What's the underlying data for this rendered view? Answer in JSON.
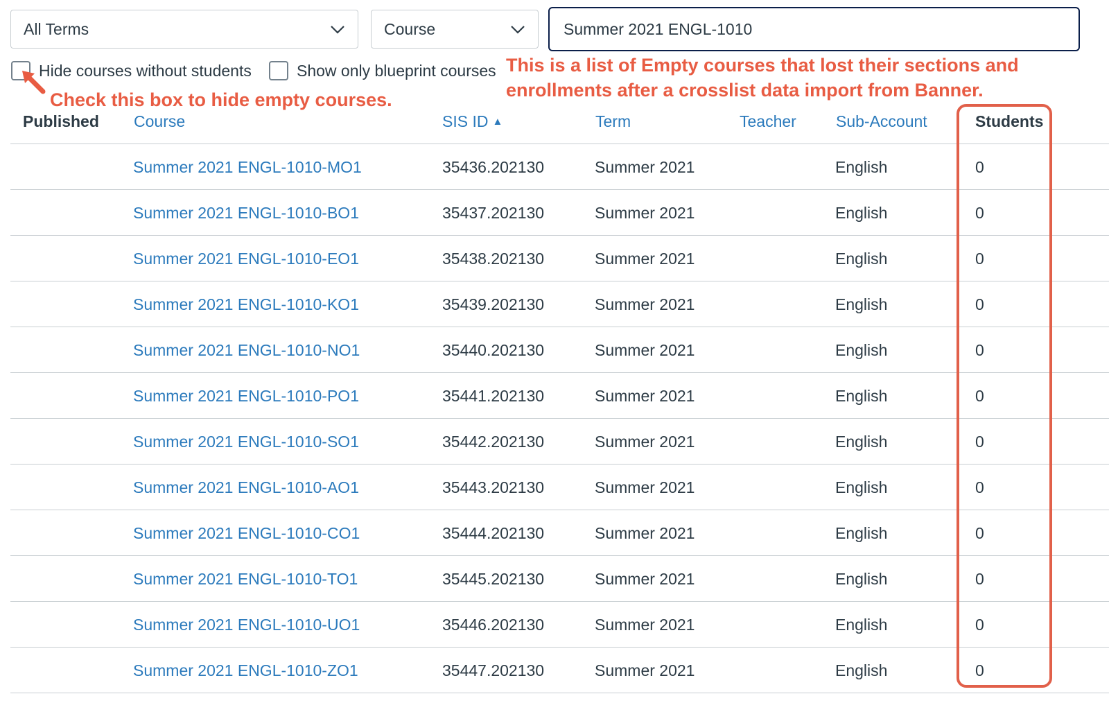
{
  "filters": {
    "term_select": "All Terms",
    "type_select": "Course",
    "search_value": "Summer 2021 ENGL-1010",
    "hide_without_students_label": "Hide courses without students",
    "blueprint_only_label": "Show only blueprint courses"
  },
  "annotations": {
    "list_note_line1": "This is a list of Empty courses that lost their sections and",
    "list_note_line2": "enrollments after a crosslist data import from Banner.",
    "checkbox_note": "Check this box to hide empty courses.",
    "accent_color": "#e85c43"
  },
  "table": {
    "headers": {
      "published": "Published",
      "course": "Course",
      "sis_id": "SIS ID",
      "sort_indicator": "▲",
      "term": "Term",
      "teacher": "Teacher",
      "sub_account": "Sub-Account",
      "students": "Students"
    },
    "rows": [
      {
        "course": "Summer 2021 ENGL-1010-MO1",
        "sis_id": "35436.202130",
        "term": "Summer 2021",
        "teacher": "",
        "sub_account": "English",
        "students": "0"
      },
      {
        "course": "Summer 2021 ENGL-1010-BO1",
        "sis_id": "35437.202130",
        "term": "Summer 2021",
        "teacher": "",
        "sub_account": "English",
        "students": "0"
      },
      {
        "course": "Summer 2021 ENGL-1010-EO1",
        "sis_id": "35438.202130",
        "term": "Summer 2021",
        "teacher": "",
        "sub_account": "English",
        "students": "0"
      },
      {
        "course": "Summer 2021 ENGL-1010-KO1",
        "sis_id": "35439.202130",
        "term": "Summer 2021",
        "teacher": "",
        "sub_account": "English",
        "students": "0"
      },
      {
        "course": "Summer 2021 ENGL-1010-NO1",
        "sis_id": "35440.202130",
        "term": "Summer 2021",
        "teacher": "",
        "sub_account": "English",
        "students": "0"
      },
      {
        "course": "Summer 2021 ENGL-1010-PO1",
        "sis_id": "35441.202130",
        "term": "Summer 2021",
        "teacher": "",
        "sub_account": "English",
        "students": "0"
      },
      {
        "course": "Summer 2021 ENGL-1010-SO1",
        "sis_id": "35442.202130",
        "term": "Summer 2021",
        "teacher": "",
        "sub_account": "English",
        "students": "0"
      },
      {
        "course": "Summer 2021 ENGL-1010-AO1",
        "sis_id": "35443.202130",
        "term": "Summer 2021",
        "teacher": "",
        "sub_account": "English",
        "students": "0"
      },
      {
        "course": "Summer 2021 ENGL-1010-CO1",
        "sis_id": "35444.202130",
        "term": "Summer 2021",
        "teacher": "",
        "sub_account": "English",
        "students": "0"
      },
      {
        "course": "Summer 2021 ENGL-1010-TO1",
        "sis_id": "35445.202130",
        "term": "Summer 2021",
        "teacher": "",
        "sub_account": "English",
        "students": "0"
      },
      {
        "course": "Summer 2021 ENGL-1010-UO1",
        "sis_id": "35446.202130",
        "term": "Summer 2021",
        "teacher": "",
        "sub_account": "English",
        "students": "0"
      },
      {
        "course": "Summer 2021 ENGL-1010-ZO1",
        "sis_id": "35447.202130",
        "term": "Summer 2021",
        "teacher": "",
        "sub_account": "English",
        "students": "0"
      }
    ]
  }
}
